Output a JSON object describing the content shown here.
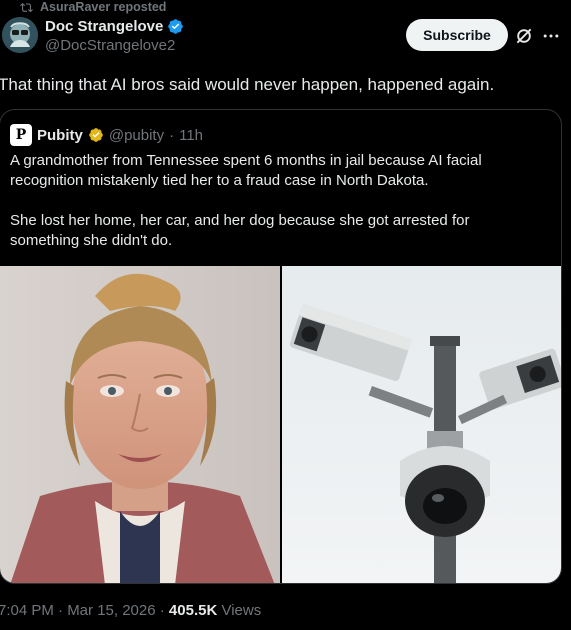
{
  "repost": {
    "label": "AsuraRaver reposted",
    "icon": "repost-icon"
  },
  "author": {
    "name": "Doc Strangelove",
    "handle": "@DocStrangelove2",
    "verified_color": "#1d9bf0"
  },
  "actions": {
    "subscribe_label": "Subscribe",
    "grok_icon": "grok-icon",
    "more_icon": "more-icon"
  },
  "tweet": {
    "text": "That thing that AI bros said would never happen, happened again."
  },
  "quote": {
    "avatar_letter": "P",
    "name": "Pubity",
    "badge_color": "#e2b719",
    "handle": "@pubity",
    "separator": "·",
    "time": "11h",
    "paragraph1": "A grandmother from Tennessee spent 6 months in jail because AI facial recognition mistakenly tied her to a fraud case in North Dakota.",
    "paragraph2": "She lost her home, her car, and her dog because she got arrested for something she didn't do."
  },
  "meta": {
    "time": "7:04 PM · Mar 15, 2026 · ",
    "views_count": "405.5K",
    "views_label": " Views"
  }
}
